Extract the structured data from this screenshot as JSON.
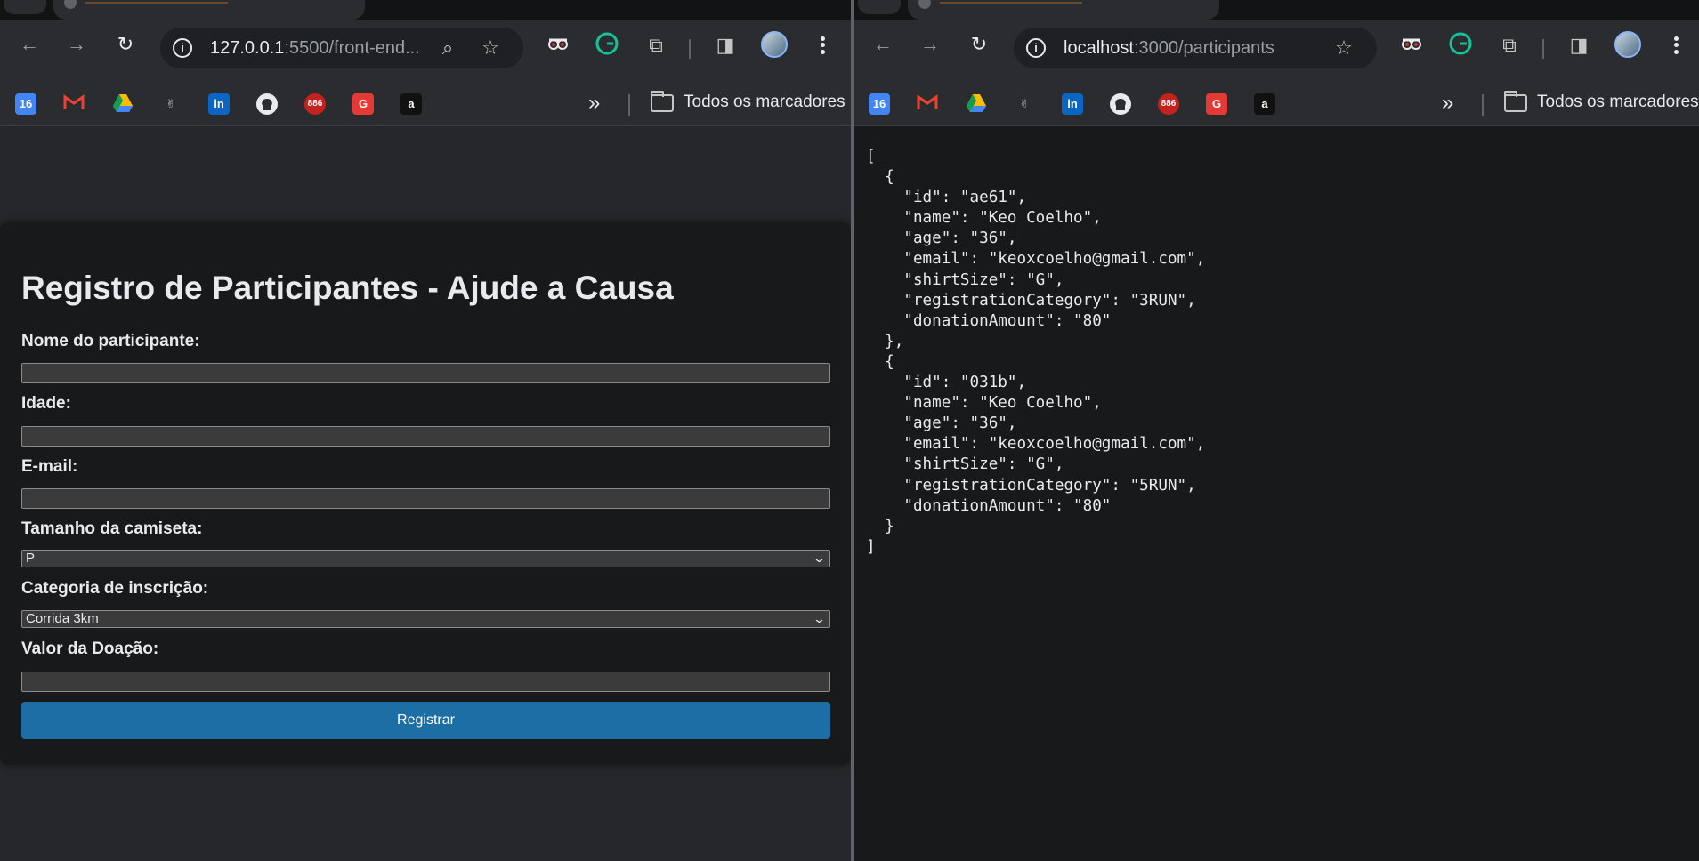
{
  "left_window": {
    "url_host": "127.0.0.1",
    "url_rest": ":5500/front-end...",
    "bookmarks": {
      "calendar_label": "16",
      "badge_886": "886",
      "more_label": "»",
      "all_bookmarks": "Todos os marcadores"
    },
    "form": {
      "title": "Registro de Participantes - Ajude a Causa",
      "name_label": "Nome do participante:",
      "age_label": "Idade:",
      "email_label": "E-mail:",
      "shirt_label": "Tamanho da camiseta:",
      "shirt_value": "P",
      "category_label": "Categoria de inscrição:",
      "category_value": "Corrida 3km",
      "donation_label": "Valor da Doação:",
      "submit_label": "Registrar"
    }
  },
  "right_window": {
    "url_host": "localhost",
    "url_rest": ":3000/participants",
    "bookmarks": {
      "calendar_label": "16",
      "badge_886": "886",
      "more_label": "»",
      "all_bookmarks": "Todos os marcadores"
    },
    "json_lines": [
      "[",
      "  {",
      "    \"id\": \"ae61\",",
      "    \"name\": \"Keo Coelho\",",
      "    \"age\": \"36\",",
      "    \"email\": \"keoxcoelho@gmail.com\",",
      "    \"shirtSize\": \"G\",",
      "    \"registrationCategory\": \"3RUN\",",
      "    \"donationAmount\": \"80\"",
      "  },",
      "  {",
      "    \"id\": \"031b\",",
      "    \"name\": \"Keo Coelho\",",
      "    \"age\": \"36\",",
      "    \"email\": \"keoxcoelho@gmail.com\",",
      "    \"shirtSize\": \"G\",",
      "    \"registrationCategory\": \"5RUN\",",
      "    \"donationAmount\": \"80\"",
      "  }",
      "]"
    ]
  },
  "icons": {
    "back": "←",
    "forward": "→",
    "reload": "↻",
    "zoom": "⌕",
    "star": "☆",
    "puzzle": "⧉",
    "sidepanel": "◨"
  },
  "colors": {
    "submit_button": "#1e6ea6",
    "page_bg_left": "#26272a",
    "page_bg_right": "#18191b"
  }
}
